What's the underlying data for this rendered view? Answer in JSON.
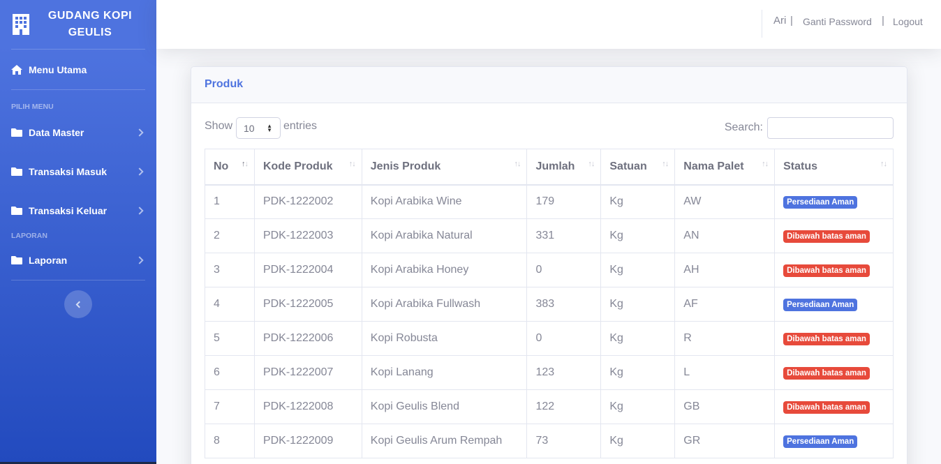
{
  "brand": {
    "line1": "GUDANG KOPI",
    "line2": "GEULIS",
    "icon": "building-icon"
  },
  "sidebar": {
    "dashboard": {
      "label": "Menu Utama",
      "icon": "home-icon"
    },
    "heading_menu": "PILIH MENU",
    "items": [
      {
        "label": "Data Master",
        "icon": "folder-icon"
      },
      {
        "label": "Transaksi Masuk",
        "icon": "folder-icon"
      },
      {
        "label": "Transaksi Keluar",
        "icon": "folder-icon"
      }
    ],
    "heading_report": "LAPORAN",
    "report": {
      "label": "Laporan",
      "icon": "folder-icon"
    }
  },
  "topbar": {
    "user": "Ari",
    "sep1": "|",
    "change_password": "Ganti Password",
    "sep2": "|",
    "logout": "Logout"
  },
  "card": {
    "title": "Produk",
    "show_label": "Show",
    "entries_value": "10",
    "entries_label": "entries",
    "search_label": "Search:"
  },
  "table": {
    "columns": [
      "No",
      "Kode Produk",
      "Jenis Produk",
      "Jumlah",
      "Satuan",
      "Nama Palet",
      "Status"
    ],
    "rows": [
      {
        "no": "1",
        "kode": "PDK-1222002",
        "jenis": "Kopi Arabika Wine",
        "jumlah": "179",
        "satuan": "Kg",
        "palet": "AW",
        "status": "Persediaan Aman",
        "status_type": "ok"
      },
      {
        "no": "2",
        "kode": "PDK-1222003",
        "jenis": "Kopi Arabika Natural",
        "jumlah": "331",
        "satuan": "Kg",
        "palet": "AN",
        "status": "Dibawah batas aman",
        "status_type": "low"
      },
      {
        "no": "3",
        "kode": "PDK-1222004",
        "jenis": "Kopi Arabika Honey",
        "jumlah": "0",
        "satuan": "Kg",
        "palet": "AH",
        "status": "Dibawah batas aman",
        "status_type": "low"
      },
      {
        "no": "4",
        "kode": "PDK-1222005",
        "jenis": "Kopi Arabika Fullwash",
        "jumlah": "383",
        "satuan": "Kg",
        "palet": "AF",
        "status": "Persediaan Aman",
        "status_type": "ok"
      },
      {
        "no": "5",
        "kode": "PDK-1222006",
        "jenis": "Kopi Robusta",
        "jumlah": "0",
        "satuan": "Kg",
        "palet": "R",
        "status": "Dibawah batas aman",
        "status_type": "low"
      },
      {
        "no": "6",
        "kode": "PDK-1222007",
        "jenis": "Kopi Lanang",
        "jumlah": "123",
        "satuan": "Kg",
        "palet": "L",
        "status": "Dibawah batas aman",
        "status_type": "low"
      },
      {
        "no": "7",
        "kode": "PDK-1222008",
        "jenis": "Kopi Geulis Blend",
        "jumlah": "122",
        "satuan": "Kg",
        "palet": "GB",
        "status": "Dibawah batas aman",
        "status_type": "low"
      },
      {
        "no": "8",
        "kode": "PDK-1222009",
        "jenis": "Kopi Geulis Arum Rempah",
        "jumlah": "73",
        "satuan": "Kg",
        "palet": "GR",
        "status": "Persediaan Aman",
        "status_type": "ok"
      }
    ]
  },
  "colors": {
    "primary": "#4e73df",
    "danger": "#e74a3b",
    "text": "#858796"
  }
}
